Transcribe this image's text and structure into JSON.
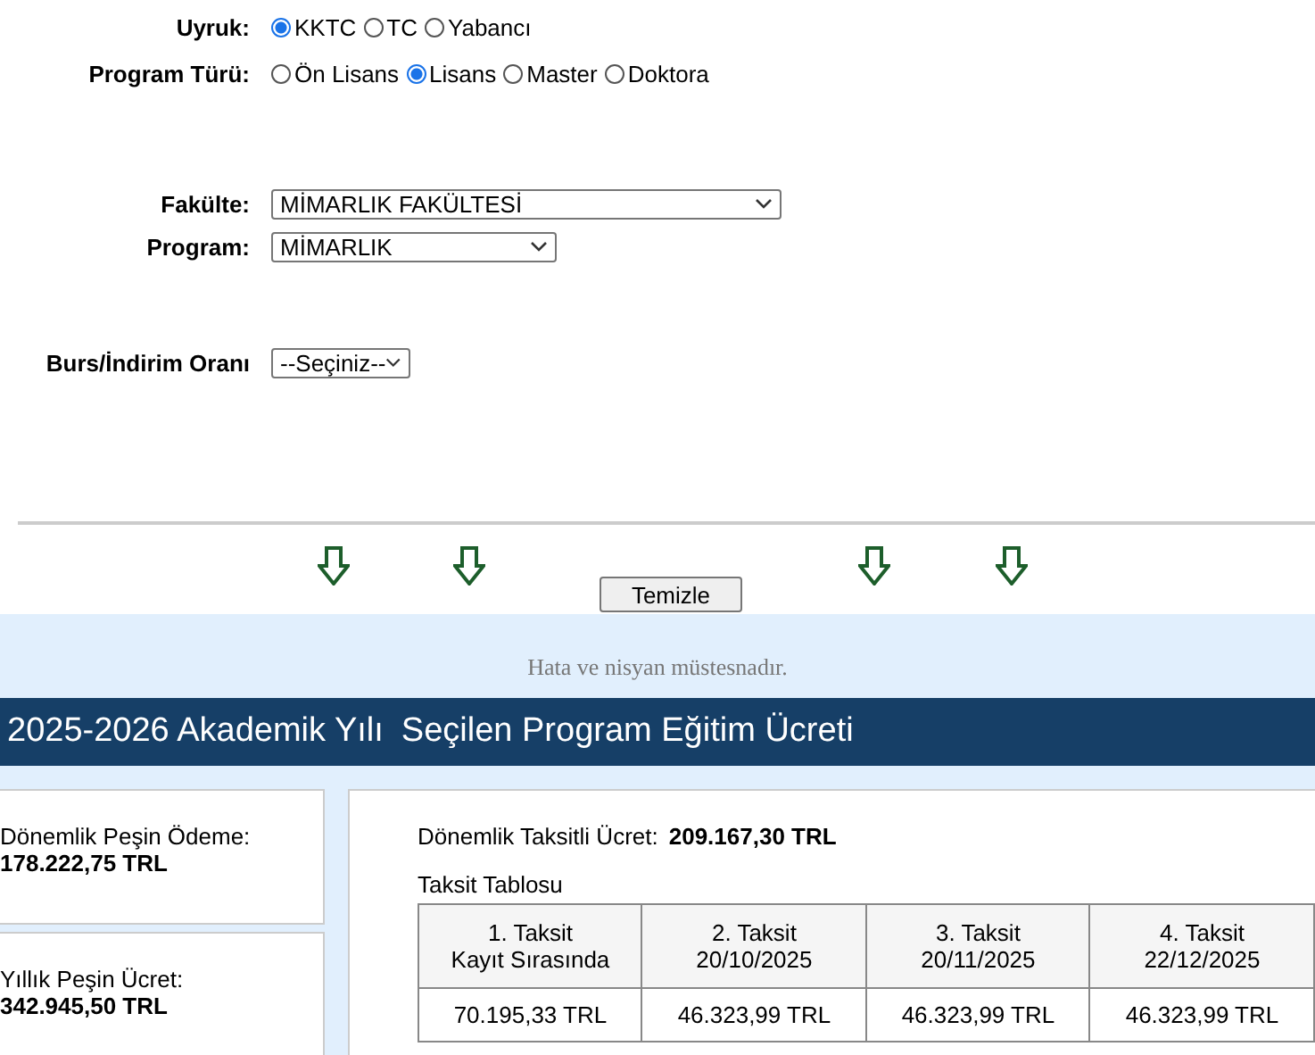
{
  "nationality": {
    "label": "Uyruk:",
    "options": [
      {
        "label": "KKTC",
        "selected": true
      },
      {
        "label": "TC",
        "selected": false
      },
      {
        "label": "Yabancı",
        "selected": false
      }
    ]
  },
  "program_type": {
    "label": "Program Türü:",
    "options": [
      {
        "label": "Ön Lisans",
        "selected": false
      },
      {
        "label": "Lisans",
        "selected": true
      },
      {
        "label": "Master",
        "selected": false
      },
      {
        "label": "Doktora",
        "selected": false
      }
    ]
  },
  "faculty": {
    "label": "Fakülte:",
    "value": "MİMARLIK FAKÜLTESİ"
  },
  "program": {
    "label": "Program:",
    "value": "MİMARLIK"
  },
  "discount": {
    "label": "Burs/İndirim Oranı",
    "value": "--Seçiniz--"
  },
  "clear_button": "Temizle",
  "disclaimer": "Hata ve nisyan müstesnadır.",
  "header": {
    "year": "2025-2026 Akademik Yılı",
    "title": "Seçilen Program Eğitim Ücreti"
  },
  "summary_cards": [
    {
      "label": "Dönemlik Peşin Ödeme:",
      "amount": "178.222,75 TRL"
    },
    {
      "label": "Yıllık Peşin Ücret:",
      "amount": "342.945,50 TRL"
    }
  ],
  "installment": {
    "label": "Dönemlik Taksitli Ücret:",
    "amount": "209.167,30 TRL",
    "table_title": "Taksit Tablosu",
    "columns": [
      {
        "title": "1. Taksit",
        "date": "Kayıt Sırasında"
      },
      {
        "title": "2. Taksit",
        "date": "20/10/2025"
      },
      {
        "title": "3. Taksit",
        "date": "20/11/2025"
      },
      {
        "title": "4. Taksit",
        "date": "22/12/2025"
      }
    ],
    "amounts": [
      "70.195,33 TRL",
      "46.323,99 TRL",
      "46.323,99 TRL",
      "46.323,99 TRL"
    ]
  }
}
